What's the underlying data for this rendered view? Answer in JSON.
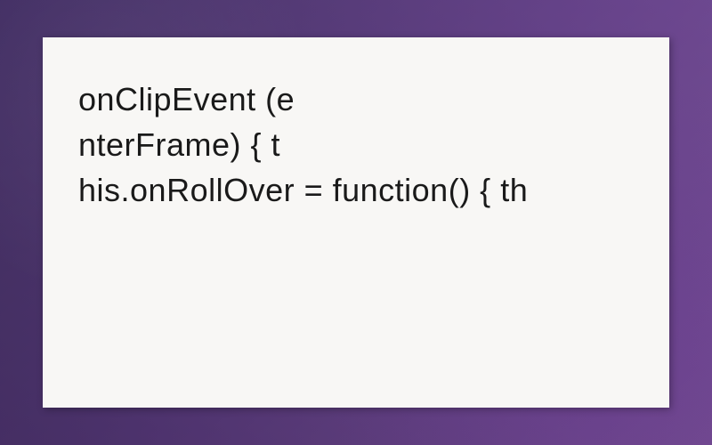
{
  "code": {
    "line1": "onClipEvent (e",
    "line2": "nterFrame) { t",
    "line3": "his.onRollOver = function() { th"
  }
}
